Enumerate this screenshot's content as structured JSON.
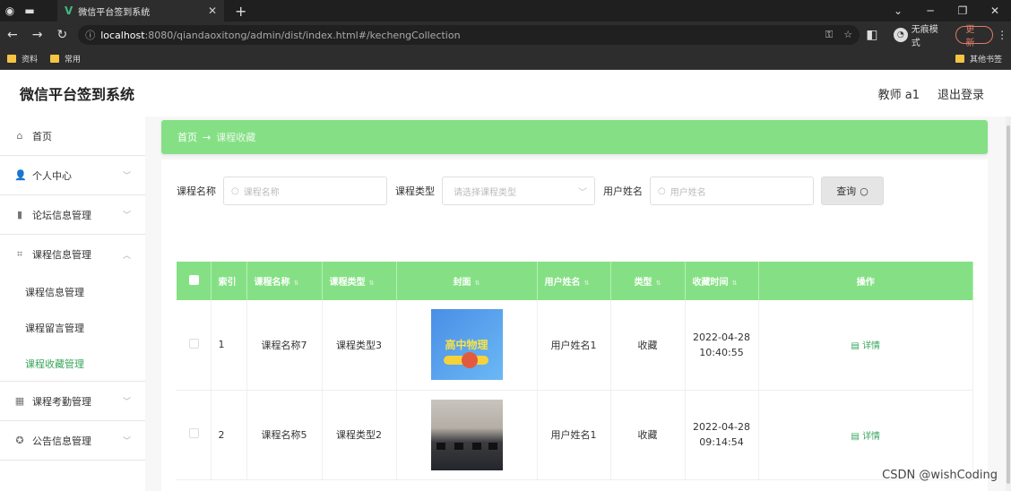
{
  "browser": {
    "tab_title": "微信平台签到系统",
    "url_host": "localhost",
    "url_rest": ":8080/qiandaoxitong/admin/dist/index.html#/kechengCollection",
    "incognito_label": "无痕模式",
    "update_label": "更新",
    "bookmarks": [
      {
        "label": "资料"
      },
      {
        "label": "常用"
      }
    ],
    "other_bookmarks": "其他书签"
  },
  "header": {
    "title": "微信平台签到系统",
    "user": "教师 a1",
    "logout": "退出登录"
  },
  "sidebar": {
    "home": "首页",
    "personal": "个人中心",
    "forum": "论坛信息管理",
    "course": "课程信息管理",
    "course_sub": [
      "课程信息管理",
      "课程留言管理",
      "课程收藏管理"
    ],
    "attendance": "课程考勤管理",
    "notice": "公告信息管理"
  },
  "breadcrumb": {
    "home": "首页",
    "arrow": "→",
    "current": "课程收藏"
  },
  "search": {
    "course_name_label": "课程名称",
    "course_name_placeholder": "课程名称",
    "course_type_label": "课程类型",
    "course_type_placeholder": "请选择课程类型",
    "user_name_label": "用户姓名",
    "user_name_placeholder": "用户姓名",
    "query_button": "查询"
  },
  "table": {
    "headers": [
      "索引",
      "课程名称",
      "课程类型",
      "封面",
      "用户姓名",
      "类型",
      "收藏时间",
      "操作"
    ],
    "rows": [
      {
        "index": "1",
        "course_name": "课程名称7",
        "course_type": "课程类型3",
        "cover_text": "高中物理",
        "user_name": "用户姓名1",
        "type": "收藏",
        "time_date": "2022-04-28",
        "time_clock": "10:40:55",
        "action": "详情"
      },
      {
        "index": "2",
        "course_name": "课程名称5",
        "course_type": "课程类型2",
        "cover_text": "",
        "user_name": "用户姓名1",
        "type": "收藏",
        "time_date": "2022-04-28",
        "time_clock": "09:14:54",
        "action": "详情"
      }
    ]
  },
  "watermark": "CSDN @wishCoding",
  "colors": {
    "accent_green": "#85e085",
    "active_link": "#3aa55c"
  }
}
